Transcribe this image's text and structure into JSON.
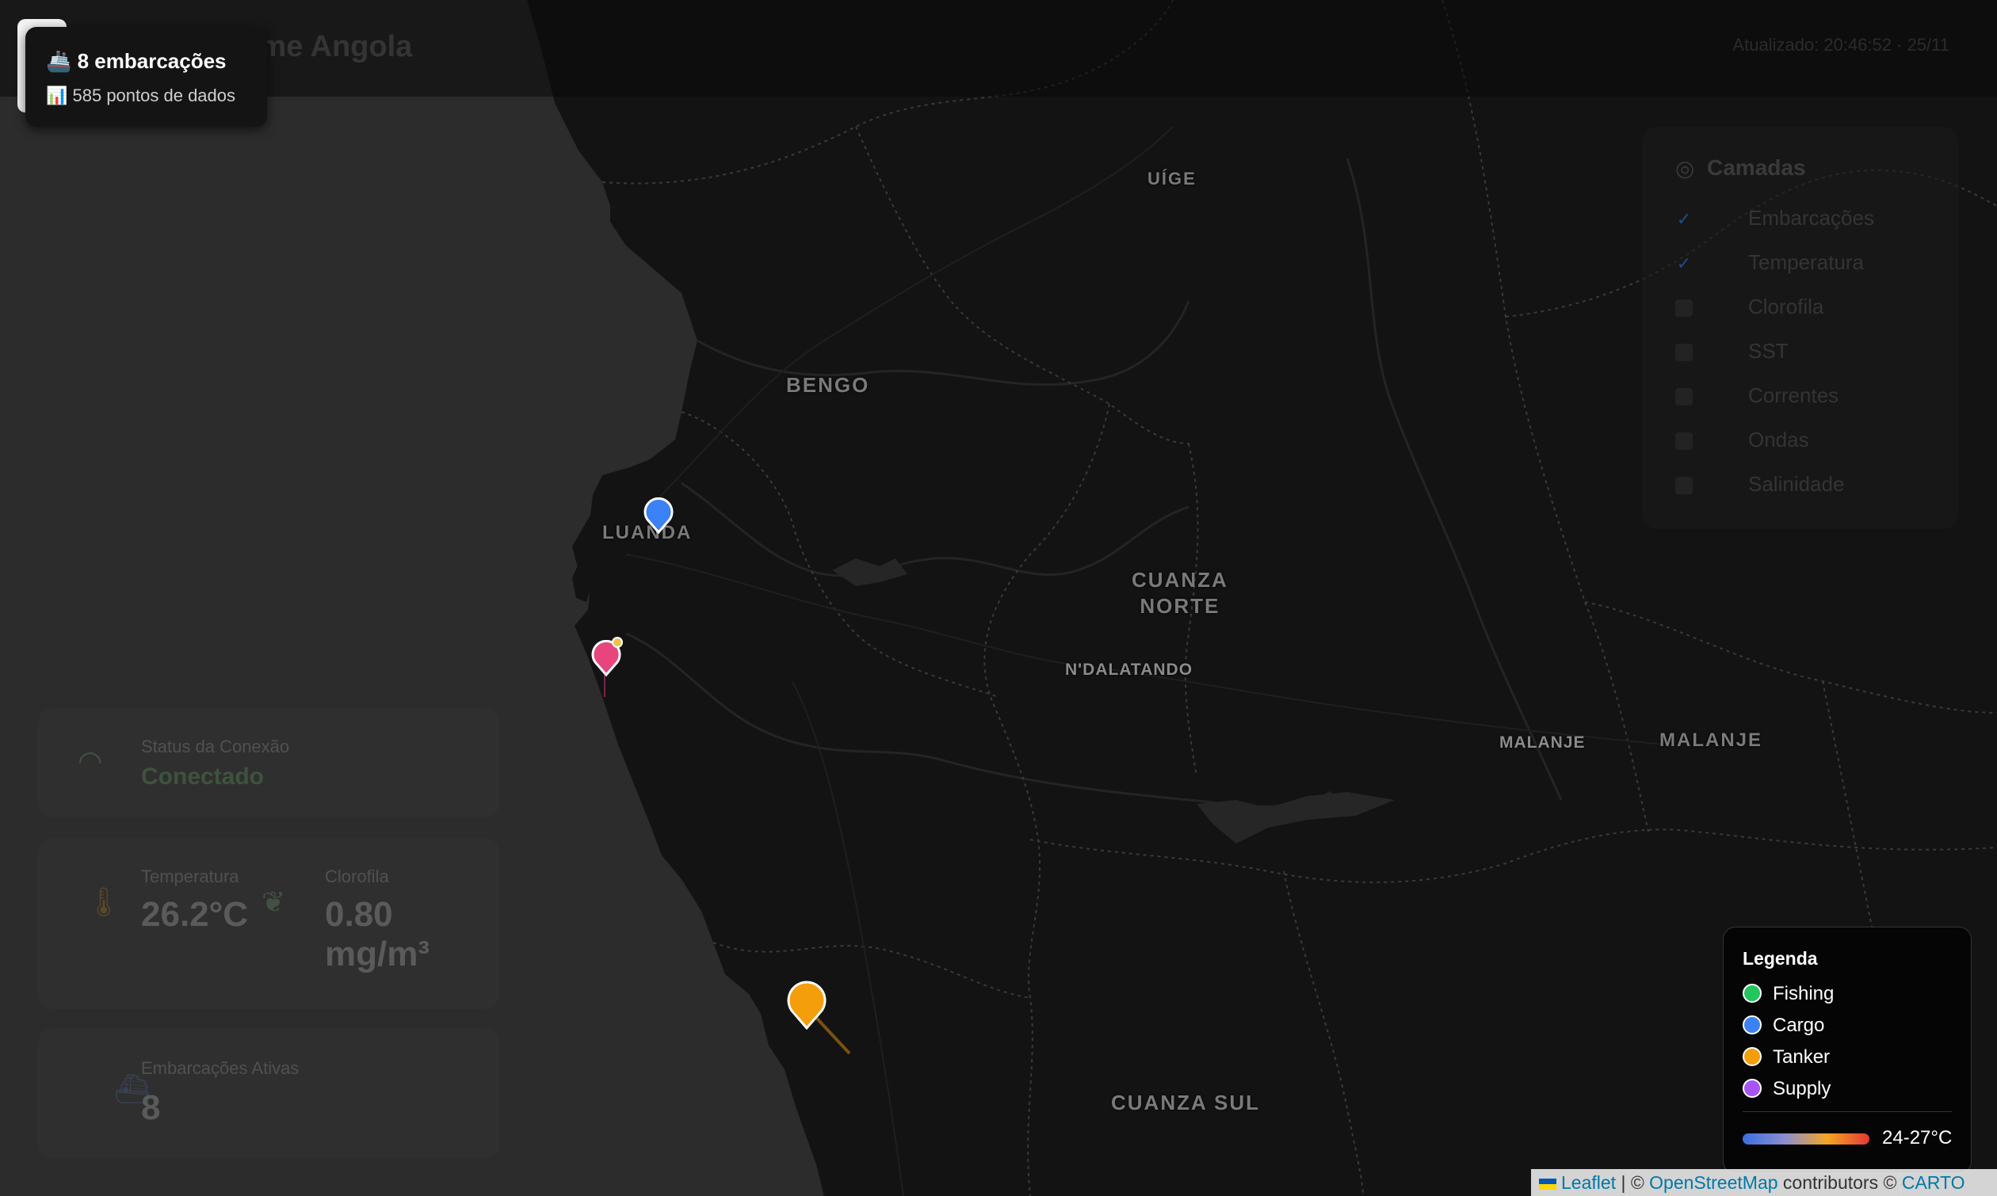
{
  "header": {
    "app_title": "al-Time Angola",
    "update_text": "Atualizado: 20:46:52 · 25/11"
  },
  "stats": {
    "vessels": "🚢 8 embarcações",
    "points": "📊 585 pontos de dados"
  },
  "layers": {
    "title": "Camadas",
    "items": [
      {
        "label": "Embarcações",
        "checked": true
      },
      {
        "label": "Temperatura",
        "checked": true
      },
      {
        "label": "Clorofila",
        "checked": false
      },
      {
        "label": "SST",
        "checked": false
      },
      {
        "label": "Correntes",
        "checked": false
      },
      {
        "label": "Ondas",
        "checked": false
      },
      {
        "label": "Salinidade",
        "checked": false
      }
    ]
  },
  "cards": {
    "connection_label": "Status da Conexão",
    "connection_value": "Conectado",
    "temp_label": "Temperatura",
    "temp_value": "26.2°C",
    "chl_label": "Clorofila",
    "chl_value": "0.80 mg/m³",
    "vessels_label": "Embarcações Ativas",
    "vessels_value": "8"
  },
  "map": {
    "regions": {
      "uige": "UÍGE",
      "bengo": "BENGO",
      "luanda": "LUANDA",
      "cuanza_norte_1": "CUANZA",
      "cuanza_norte_2": "NORTE",
      "ndalatando": "N'DALATANDO",
      "malanje_city": "MALANJE",
      "malanje": "MALANJE",
      "cuanza_sul": "CUANZA SUL"
    }
  },
  "legend": {
    "title": "Legenda",
    "items": [
      {
        "label": "Fishing",
        "color": "#22c55e"
      },
      {
        "label": "Cargo",
        "color": "#3b82f6"
      },
      {
        "label": "Tanker",
        "color": "#f59e0b"
      },
      {
        "label": "Supply",
        "color": "#a855f7"
      }
    ],
    "range": "24-27°C"
  },
  "attribution": {
    "leaflet": "Leaflet",
    "sep": " | © ",
    "osm": "OpenStreetMap",
    "contrib": " contributors © ",
    "carto": "CARTO"
  }
}
